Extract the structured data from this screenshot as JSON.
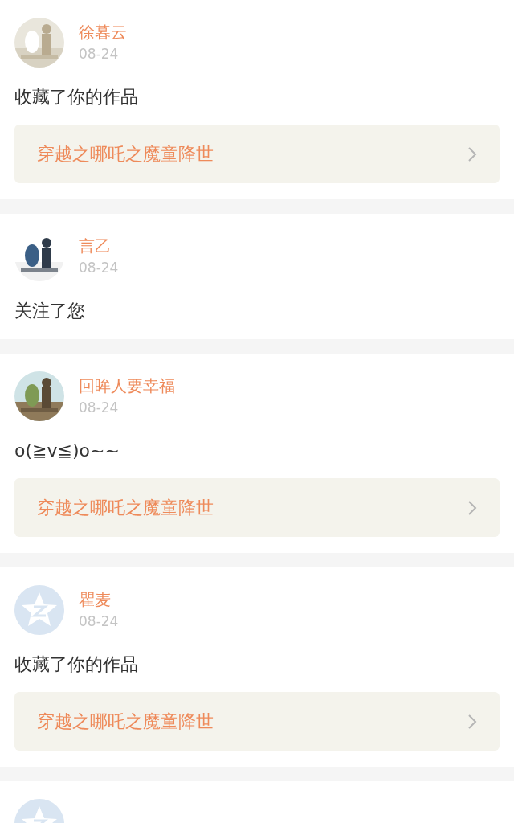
{
  "notifications": [
    {
      "user": "徐暮云",
      "date": "08-24",
      "message": "收藏了你的作品",
      "work": "穿越之哪吒之魔童降世"
    },
    {
      "user": "言乙",
      "date": "08-24",
      "message": "关注了您"
    },
    {
      "user": "回眸人要幸福",
      "date": "08-24",
      "message": "o(≧v≦)o~~",
      "work": "穿越之哪吒之魔童降世"
    },
    {
      "user": "瞿麦",
      "date": "08-24",
      "avatar": {
        "kind": "default"
      },
      "message": "收藏了你的作品",
      "work": "穿越之哪吒之魔童降世"
    },
    {
      "avatar": {
        "kind": "default"
      }
    }
  ]
}
